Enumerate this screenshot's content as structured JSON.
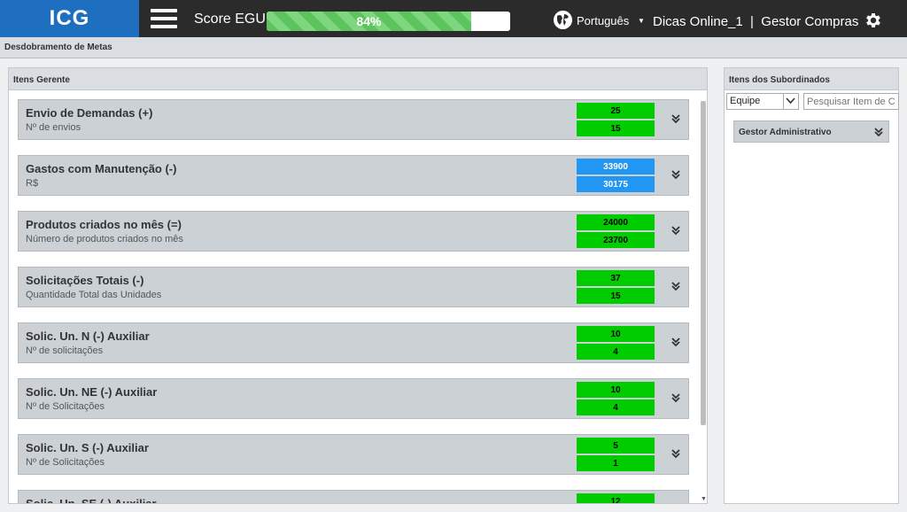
{
  "header": {
    "logo": "ICG",
    "score_label": "Score EGU:",
    "score_percent": 84,
    "score_text": "84%",
    "language": "Português",
    "user": "Dicas Online_1  |  Gestor Compras"
  },
  "page": {
    "title": "Desdobramento de Metas"
  },
  "left_panel": {
    "title": "Itens Gerente",
    "items": [
      {
        "title": "Envio de Demandas (+)",
        "subtitle": "Nº de envios",
        "top": "25",
        "bottom": "15",
        "color": "#00cc00"
      },
      {
        "title": "Gastos com Manutenção (-)",
        "subtitle": "R$",
        "top": "33900",
        "bottom": "30175",
        "color": "#2196f3"
      },
      {
        "title": "Produtos criados no mês (=)",
        "subtitle": "Número de produtos criados no mês",
        "top": "24000",
        "bottom": "23700",
        "color": "#00cc00"
      },
      {
        "title": "Solicitações Totais (-)",
        "subtitle": "Quantidade Total das Unidades",
        "top": "37",
        "bottom": "15",
        "color": "#00cc00"
      },
      {
        "title": "Solic. Un. N (-) Auxiliar",
        "subtitle": "Nº de solicitações",
        "top": "10",
        "bottom": "4",
        "color": "#00cc00"
      },
      {
        "title": "Solic. Un. NE (-) Auxiliar",
        "subtitle": "Nº de Solicitações",
        "top": "10",
        "bottom": "4",
        "color": "#00cc00"
      },
      {
        "title": "Solic. Un. S (-) Auxiliar",
        "subtitle": "Nº de Solicitações",
        "top": "5",
        "bottom": "1",
        "color": "#00cc00"
      },
      {
        "title": "Solic. Un. SE (-) Auxiliar",
        "subtitle": "",
        "top": "12",
        "bottom": "",
        "color": "#00cc00"
      }
    ]
  },
  "right_panel": {
    "title": "Itens dos Subordinados",
    "filter_value": "Equipe",
    "search_placeholder": "Pesquisar Item de Controle",
    "items": [
      {
        "label": "Gestor Administrativo"
      }
    ]
  },
  "icons": {
    "menu": "hamburger-menu-icon",
    "language": "globe-icon",
    "settings": "gear-icon",
    "expand": "double-chevron-down-icon"
  }
}
